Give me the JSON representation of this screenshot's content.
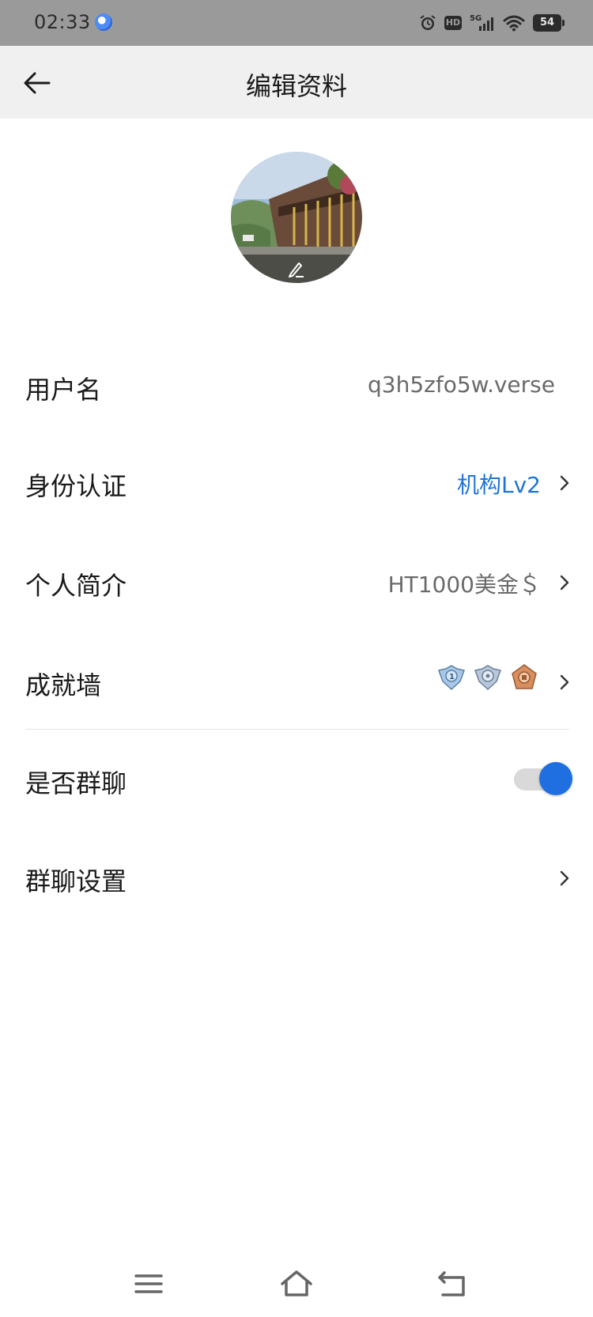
{
  "status_bar": {
    "time": "02:33",
    "battery": "54",
    "hd_label": "HD",
    "network_label": "5G",
    "icons": [
      "app-notification-icon",
      "alarm-icon",
      "hd-icon",
      "signal-5g-icon",
      "wifi-icon",
      "battery-icon"
    ]
  },
  "header": {
    "title": "编辑资料",
    "back_icon": "arrow-left-icon"
  },
  "avatar": {
    "edit_icon": "pencil-icon"
  },
  "rows": {
    "username": {
      "label": "用户名",
      "value": "q3h5zfo5w.verse"
    },
    "identity": {
      "label": "身份认证",
      "value": "机构Lv2"
    },
    "bio": {
      "label": "个人简介",
      "value": "HT1000美金＄"
    },
    "achievements": {
      "label": "成就墙",
      "badges": [
        "badge-icon-1",
        "badge-icon-2",
        "badge-icon-3"
      ]
    },
    "group_chat": {
      "label": "是否群聊",
      "enabled": true
    },
    "group_settings": {
      "label": "群聊设置"
    }
  },
  "colors": {
    "accent": "#1f74d6",
    "toggle_on": "#1f6fe0",
    "header_bg": "#f0f0f0",
    "status_bar_bg": "#9a9a9a"
  },
  "nav_bar": {
    "icons": [
      "menu-icon",
      "home-icon",
      "back-nav-icon"
    ]
  }
}
